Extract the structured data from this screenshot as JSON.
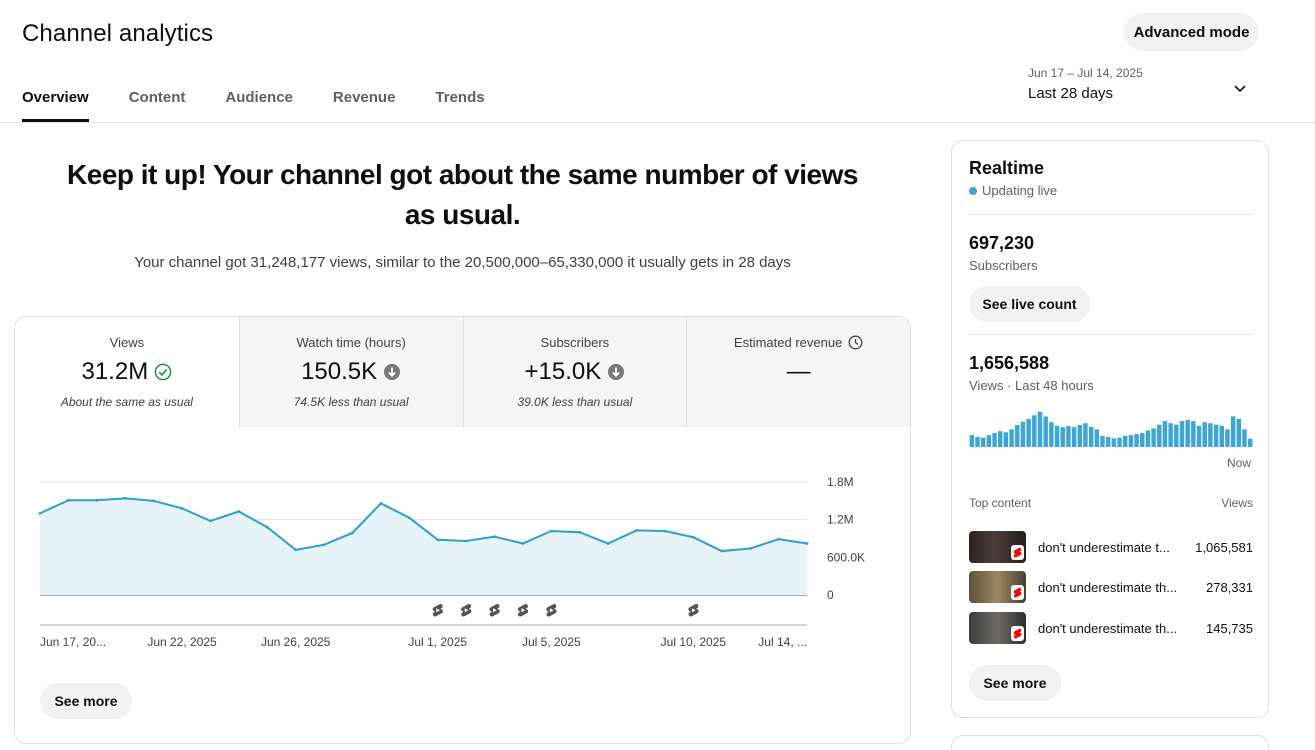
{
  "header": {
    "title": "Channel analytics",
    "advanced_mode": "Advanced mode",
    "tabs": [
      {
        "label": "Overview"
      },
      {
        "label": "Content"
      },
      {
        "label": "Audience"
      },
      {
        "label": "Revenue"
      },
      {
        "label": "Trends"
      }
    ],
    "active_tab": "Overview",
    "date_range": "Jun 17 – Jul 14, 2025",
    "date_label": "Last 28 days"
  },
  "summary": {
    "headline": "Keep it up! Your channel got about the same number of views as usual.",
    "subhead": "Your channel got 31,248,177 views, similar to the 20,500,000–65,330,000 it usually gets in 28 days"
  },
  "metrics": [
    {
      "label": "Views",
      "value": "31.2M",
      "note": "About the same as usual",
      "icon": "check-circle-icon"
    },
    {
      "label": "Watch time (hours)",
      "value": "150.5K",
      "note": "74.5K less than usual",
      "icon": "arrow-down-circle-icon"
    },
    {
      "label": "Subscribers",
      "value": "+15.0K",
      "note": "39.0K less than usual",
      "icon": "arrow-down-circle-icon"
    },
    {
      "label": "Estimated revenue",
      "value": "—",
      "note": "",
      "icon": "clock-icon"
    }
  ],
  "chart_data": {
    "type": "area",
    "x": [
      "2025-06-17",
      "2025-06-18",
      "2025-06-19",
      "2025-06-20",
      "2025-06-21",
      "2025-06-22",
      "2025-06-23",
      "2025-06-24",
      "2025-06-25",
      "2025-06-26",
      "2025-06-27",
      "2025-06-28",
      "2025-06-29",
      "2025-06-30",
      "2025-07-01",
      "2025-07-02",
      "2025-07-03",
      "2025-07-04",
      "2025-07-05",
      "2025-07-06",
      "2025-07-07",
      "2025-07-08",
      "2025-07-09",
      "2025-07-10",
      "2025-07-11",
      "2025-07-12",
      "2025-07-13",
      "2025-07-14"
    ],
    "tick_labels": [
      {
        "index": 0,
        "label": "Jun 17, 20..."
      },
      {
        "index": 5,
        "label": "Jun 22, 2025"
      },
      {
        "index": 9,
        "label": "Jun 26, 2025"
      },
      {
        "index": 14,
        "label": "Jul 1, 2025"
      },
      {
        "index": 18,
        "label": "Jul 5, 2025"
      },
      {
        "index": 23,
        "label": "Jul 10, 2025"
      },
      {
        "index": 27,
        "label": "Jul 14, ..."
      }
    ],
    "series": [
      {
        "values": [
          1300000,
          1510000,
          1510000,
          1540000,
          1500000,
          1380000,
          1180000,
          1330000,
          1080000,
          720000,
          800000,
          990000,
          1460000,
          1230000,
          880000,
          860000,
          930000,
          820000,
          1020000,
          1000000,
          820000,
          1030000,
          1020000,
          920000,
          700000,
          740000,
          890000,
          820000
        ],
        "color": "#2ea0cf"
      }
    ],
    "yticks": [
      "0",
      "600.0K",
      "1.2M",
      "1.8M"
    ],
    "ylim": [
      0,
      1800000
    ],
    "grid": true,
    "shorts_markers": [
      14,
      15,
      16,
      17,
      18,
      23
    ]
  },
  "main_see_more": "See more",
  "realtime": {
    "title": "Realtime",
    "live": "Updating live",
    "subscribers_value": "697,230",
    "subscribers_label": "Subscribers",
    "live_count_btn": "See live count",
    "views_value": "1,656,588",
    "views_label": "Views · Last 48 hours",
    "spark_values": [
      0.33,
      0.28,
      0.26,
      0.33,
      0.39,
      0.44,
      0.41,
      0.49,
      0.61,
      0.7,
      0.78,
      0.88,
      0.98,
      0.85,
      0.69,
      0.59,
      0.55,
      0.58,
      0.55,
      0.61,
      0.66,
      0.56,
      0.49,
      0.31,
      0.28,
      0.24,
      0.26,
      0.31,
      0.33,
      0.36,
      0.39,
      0.46,
      0.52,
      0.62,
      0.72,
      0.66,
      0.62,
      0.72,
      0.75,
      0.72,
      0.59,
      0.69,
      0.66,
      0.62,
      0.59,
      0.49,
      0.85,
      0.78,
      0.49,
      0.23
    ],
    "now_label": "Now",
    "top_content_label": "Top content",
    "views_col": "Views",
    "top_content": [
      {
        "title": "don't underestimate t...",
        "views": "1,065,581",
        "thumb": "#3b3230"
      },
      {
        "title": "don't underestimate th...",
        "views": "278,331",
        "thumb": "#7a6a4e"
      },
      {
        "title": "don't underestimate th...",
        "views": "145,735",
        "thumb": "#4a4c4a"
      }
    ],
    "see_more": "See more"
  }
}
